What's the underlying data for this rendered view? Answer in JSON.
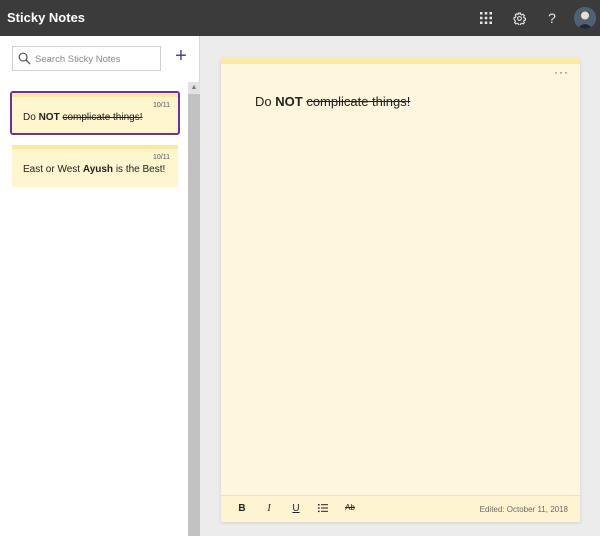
{
  "app": {
    "title": "Sticky Notes"
  },
  "topbar": {
    "icons": [
      "apps-grid-icon",
      "gear-icon",
      "help-icon",
      "avatar"
    ],
    "help_glyph": "?"
  },
  "sidebar": {
    "search_placeholder": "Search Sticky Notes",
    "add_glyph": "+",
    "notes": [
      {
        "date": "10/11",
        "text_pre": "Do ",
        "text_bold": "NOT",
        "text_space": " ",
        "text_strike": "complicate things!",
        "selected": true
      },
      {
        "date": "10/11",
        "text_pre": "East or West ",
        "text_bold": "Ayush",
        "text_post": " is the Best!",
        "selected": false
      }
    ]
  },
  "editor": {
    "text_pre": "Do ",
    "text_bold": "NOT",
    "text_space": " ",
    "text_strike": "complicate things!",
    "more_glyph": "···",
    "format": {
      "bold": "B",
      "italic": "I",
      "underline": "U",
      "strike": "Ab"
    },
    "edited": "Edited: October 11, 2018"
  },
  "colors": {
    "accent": "#6e2fa0",
    "note_bg": "#fff7dd",
    "topbar": "#3b3b3b",
    "add": "#4b3fb0"
  }
}
